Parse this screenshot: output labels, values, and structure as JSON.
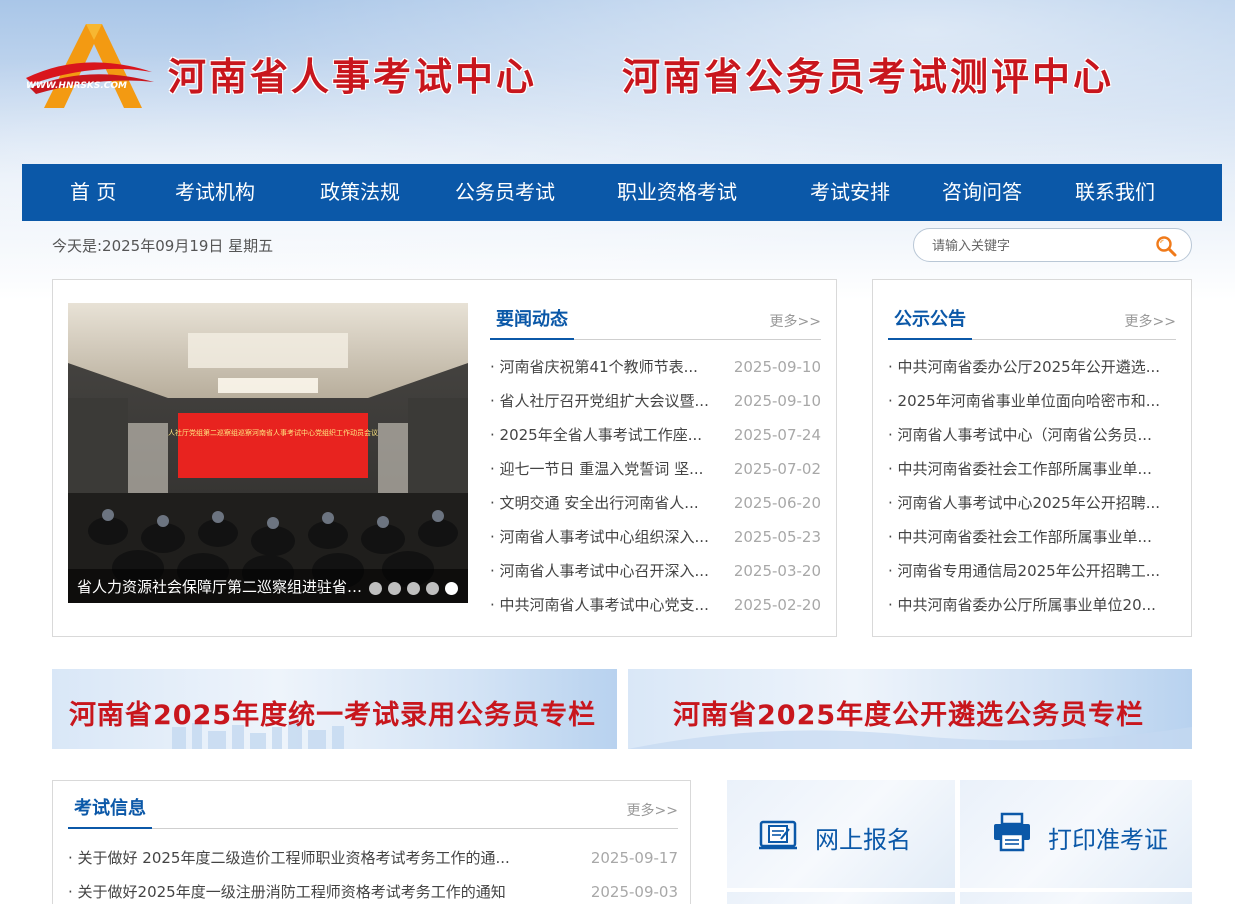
{
  "header": {
    "logo_text": "WWW.HNRSKS.COM",
    "title_left": "河南省人事考试中心",
    "title_right": "河南省公务员考试测评中心"
  },
  "nav": {
    "items": [
      "首 页",
      "考试机构",
      "政策法规",
      "公务员考试",
      "职业资格考试",
      "考试安排",
      "咨询问答",
      "联系我们"
    ]
  },
  "date_line": "今天是:2025年09月19日 星期五",
  "search": {
    "placeholder": "请输入关键字"
  },
  "slider": {
    "caption": "省人力资源社会保障厅第二巡察组进驻省人事考试中心开展巡察工作",
    "screen_text": "人社厅党组第二巡察组巡察河南省人事考试中心党组织工作动员会议",
    "dots": 5,
    "active_dot": 5
  },
  "news": {
    "title": "要闻动态",
    "more": "更多>>",
    "items": [
      {
        "title": "· 河南省庆祝第41个教师节表...",
        "date": "2025-09-10"
      },
      {
        "title": "· 省人社厅召开党组扩大会议暨...",
        "date": "2025-09-10"
      },
      {
        "title": "· 2025年全省人事考试工作座...",
        "date": "2025-07-24"
      },
      {
        "title": "· 迎七一节日 重温入党誓词 坚...",
        "date": "2025-07-02"
      },
      {
        "title": "· 文明交通 安全出行河南省人...",
        "date": "2025-06-20"
      },
      {
        "title": "· 河南省人事考试中心组织深入...",
        "date": "2025-05-23"
      },
      {
        "title": "· 河南省人事考试中心召开深入...",
        "date": "2025-03-20"
      },
      {
        "title": "· 中共河南省人事考试中心党支...",
        "date": "2025-02-20"
      }
    ]
  },
  "notices": {
    "title": "公示公告",
    "more": "更多>>",
    "items": [
      "· 中共河南省委办公厅2025年公开遴选...",
      "· 2025年河南省事业单位面向哈密市和...",
      "· 河南省人事考试中心（河南省公务员...",
      "· 中共河南省委社会工作部所属事业单...",
      "· 河南省人事考试中心2025年公开招聘...",
      "· 中共河南省委社会工作部所属事业单...",
      "· 河南省专用通信局2025年公开招聘工...",
      "· 中共河南省委办公厅所属事业单位20..."
    ]
  },
  "banners": [
    "河南省2025年度统一考试录用公务员专栏",
    "河南省2025年度公开遴选公务员专栏"
  ],
  "exam_info": {
    "title": "考试信息",
    "more": "更多>>",
    "items": [
      {
        "title": "· 关于做好 2025年度二级造价工程师职业资格考试考务工作的通...",
        "date": "2025-09-17"
      },
      {
        "title": "· 关于做好2025年度一级注册消防工程师资格考试考务工作的通知",
        "date": "2025-09-03"
      }
    ]
  },
  "quick_links": {
    "register": "网上报名",
    "print_ticket": "打印准考证"
  },
  "colors": {
    "nav_blue": "#0b58a8",
    "title_red": "#c8161d",
    "date_gray": "#a8a8a8"
  }
}
